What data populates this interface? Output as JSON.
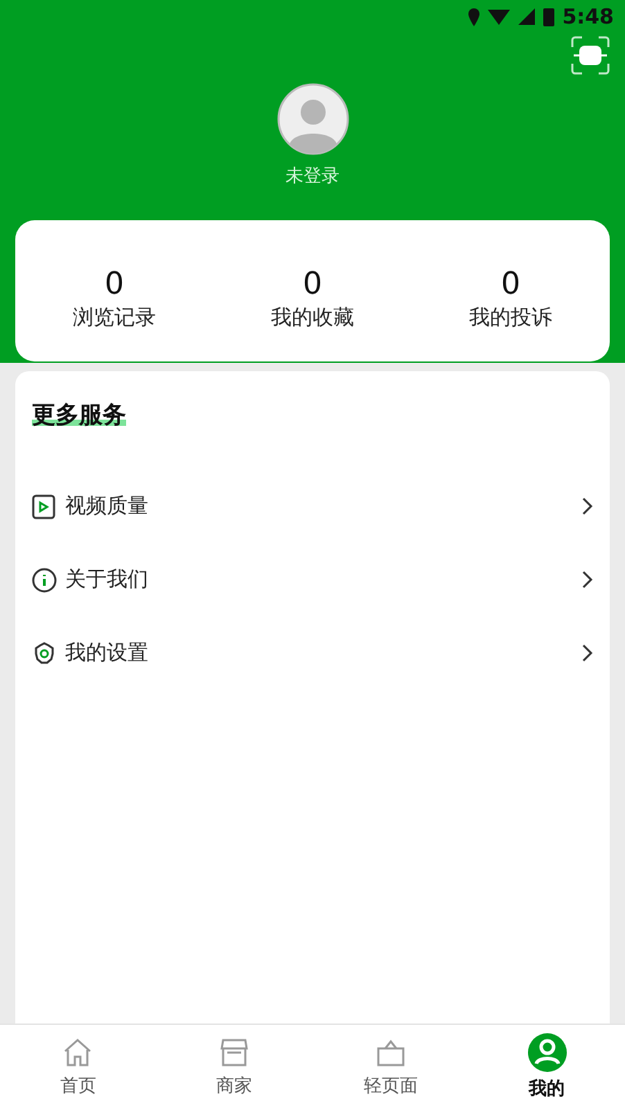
{
  "status_bar": {
    "time": "5:48"
  },
  "profile": {
    "name": "未登录"
  },
  "stats": [
    {
      "value": "0",
      "label": "浏览记录"
    },
    {
      "value": "0",
      "label": "我的收藏"
    },
    {
      "value": "0",
      "label": "我的投诉"
    }
  ],
  "services": {
    "title": "更多服务",
    "items": [
      {
        "kind": "video",
        "label": "视频质量"
      },
      {
        "kind": "info",
        "label": "关于我们"
      },
      {
        "kind": "settings",
        "label": "我的设置"
      }
    ]
  },
  "tabs": [
    {
      "kind": "home",
      "label": "首页",
      "selected": false
    },
    {
      "kind": "shop",
      "label": "商家",
      "selected": false
    },
    {
      "kind": "bag",
      "label": "轻页面",
      "selected": false
    },
    {
      "kind": "user",
      "label": "我的",
      "selected": true
    }
  ]
}
